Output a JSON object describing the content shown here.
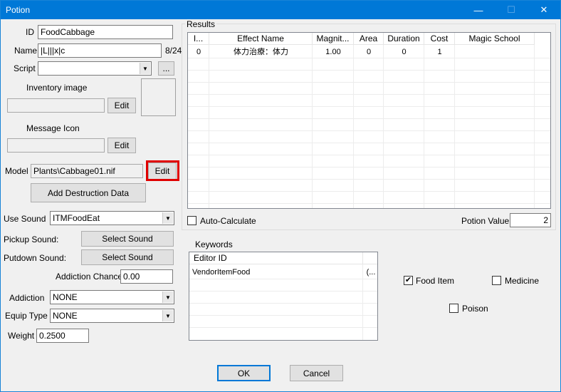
{
  "window": {
    "title": "Potion",
    "minimize": "—",
    "maximize": "☐",
    "close": "✕"
  },
  "form": {
    "id_label": "ID",
    "id_value": "FoodCabbage",
    "name_label": "Name",
    "name_value": "|L|||x|c",
    "name_count": "8/24",
    "script_label": "Script",
    "script_value": "",
    "script_browse": "...",
    "inventory_image_label": "Inventory image",
    "inventory_image_value": "",
    "edit_label": "Edit",
    "message_icon_label": "Message Icon",
    "message_icon_value": "",
    "model_label": "Model",
    "model_value": "Plants\\Cabbage01.nif",
    "add_destruction_label": "Add Destruction Data",
    "use_sound_label": "Use Sound",
    "use_sound_value": "ITMFoodEat",
    "pickup_sound_label": "Pickup Sound:",
    "putdown_sound_label": "Putdown Sound:",
    "select_sound_label": "Select Sound",
    "addiction_chance_label": "Addiction Chance",
    "addiction_chance_value": "0.00",
    "addiction_label": "Addiction",
    "addiction_value": "NONE",
    "equip_type_label": "Equip Type",
    "equip_type_value": "NONE",
    "weight_label": "Weight",
    "weight_value": "0.2500"
  },
  "results": {
    "group_title": "Results",
    "columns": [
      "I...",
      "Effect Name",
      "Magnit...",
      "Area",
      "Duration",
      "Cost",
      "Magic School"
    ],
    "rows": [
      {
        "index": "0",
        "effect": "体力治療：体力",
        "magnitude": "1.00",
        "area": "0",
        "duration": "0",
        "cost": "1",
        "school": ""
      }
    ],
    "auto_calculate_label": "Auto-Calculate",
    "auto_calculate_checked": false,
    "potion_value_label": "Potion Value",
    "potion_value": "2"
  },
  "keywords": {
    "group_title": "Keywords",
    "columns": [
      "Editor ID",
      ""
    ],
    "rows": [
      {
        "editor_id": "VendorItemFood",
        "extra": "(..."
      }
    ]
  },
  "flags": {
    "food_item_label": "Food Item",
    "food_item_checked": true,
    "medicine_label": "Medicine",
    "medicine_checked": false,
    "poison_label": "Poison",
    "poison_checked": false
  },
  "footer": {
    "ok_label": "OK",
    "cancel_label": "Cancel"
  },
  "icons": {
    "dropdown": "dropdown-arrow-icon",
    "check": "checkmark-icon"
  },
  "colors": {
    "titlebar": "#0078d7",
    "highlight": "#e00000"
  }
}
